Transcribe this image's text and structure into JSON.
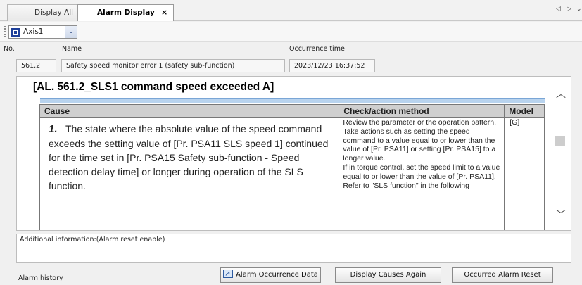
{
  "tabs": [
    {
      "label": "Display All"
    },
    {
      "label": "Alarm Display",
      "close": "×"
    }
  ],
  "tab_nav": {
    "prev": "◁",
    "next": "▷",
    "menu": "⌄"
  },
  "toolbar": {
    "axis_value": "Axis1",
    "dropdown_arrow": "⌄"
  },
  "header": {
    "no_label": "No.",
    "name_label": "Name",
    "time_label": "Occurrence time",
    "no_value": "561.2",
    "name_value": "Safety speed monitor error 1 (safety sub-function)",
    "time_value": "2023/12/23 16:37:52"
  },
  "detail": {
    "title": "[AL. 561.2_SLS1 command speed exceeded A]",
    "columns": [
      "Cause",
      "Check/action method",
      "Model"
    ],
    "rows": [
      {
        "num": "1.",
        "cause": "The state where the absolute value of the speed command exceeds the setting value of [Pr. PSA11 SLS speed 1] continued for the time set in [Pr. PSA15 Safety sub-function - Speed detection delay time] or longer during operation of the SLS function.",
        "check": [
          "Review the parameter or the operation pattern.",
          "Take actions such as setting the speed command to a value equal to or lower than the value of [Pr. PSA11] or setting [Pr. PSA15] to a longer value.",
          "If in torque control, set the speed limit to a value equal to or lower than the value of [Pr. PSA11].",
          "Refer to \"SLS function\" in the following"
        ],
        "model": "[G]"
      }
    ]
  },
  "additional_info": "Additional information:(Alarm reset enable)",
  "bottom": {
    "history_label": "Alarm history",
    "btn_occurrence": "Alarm Occurrence Data",
    "btn_causes": "Display Causes Again",
    "btn_reset": "Occurred Alarm Reset"
  },
  "colors": {
    "title_rule": "#b8d3ee",
    "axis_icon": "#1e3f99",
    "header_gray": "#cfcfcf"
  },
  "icons": [
    "axis-icon",
    "close-icon",
    "dropdown-arrow-icon",
    "scroll-up-icon",
    "scroll-down-icon",
    "open-window-icon"
  ]
}
